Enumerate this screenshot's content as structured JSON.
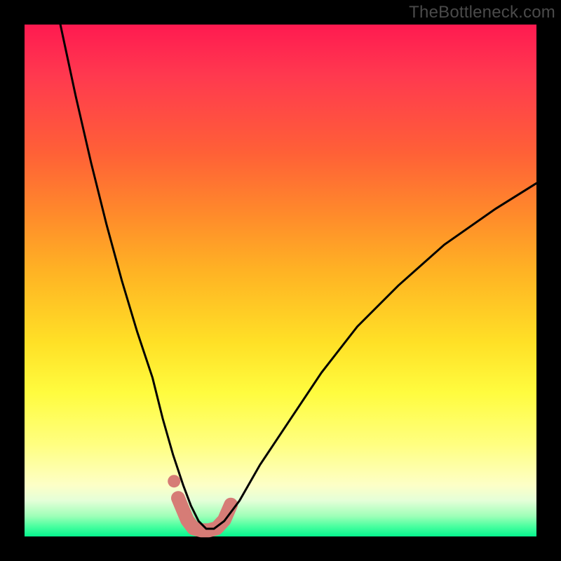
{
  "watermark": "TheBottleneck.com",
  "chart_data": {
    "type": "line",
    "title": "",
    "xlabel": "",
    "ylabel": "",
    "xlim": [
      0,
      100
    ],
    "ylim": [
      0,
      100
    ],
    "series": [
      {
        "name": "bottleneck-curve",
        "x": [
          7,
          10,
          13,
          16,
          19,
          22,
          25,
          27,
          29,
          31,
          32.5,
          34,
          35.5,
          37,
          39,
          42,
          46,
          52,
          58,
          65,
          73,
          82,
          92,
          100
        ],
        "y": [
          100,
          86,
          73,
          61,
          50,
          40,
          31,
          23,
          16,
          10,
          6,
          3,
          1.5,
          1.5,
          3,
          7,
          14,
          23,
          32,
          41,
          49,
          57,
          64,
          69
        ]
      },
      {
        "name": "highlight-basin",
        "x": [
          30,
          31.8,
          33,
          34.5,
          36,
          37.5,
          39,
          40.3
        ],
        "y": [
          7.5,
          3.2,
          1.6,
          1.2,
          1.2,
          1.6,
          3.2,
          6.2
        ]
      },
      {
        "name": "highlight-dot",
        "x": [
          29.2
        ],
        "y": [
          10.8
        ]
      }
    ],
    "colors": {
      "curve": "#000000",
      "highlight": "#d67c76",
      "gradient_top": "#ff1a50",
      "gradient_mid": "#ffe026",
      "gradient_bottom": "#06f58e"
    }
  }
}
